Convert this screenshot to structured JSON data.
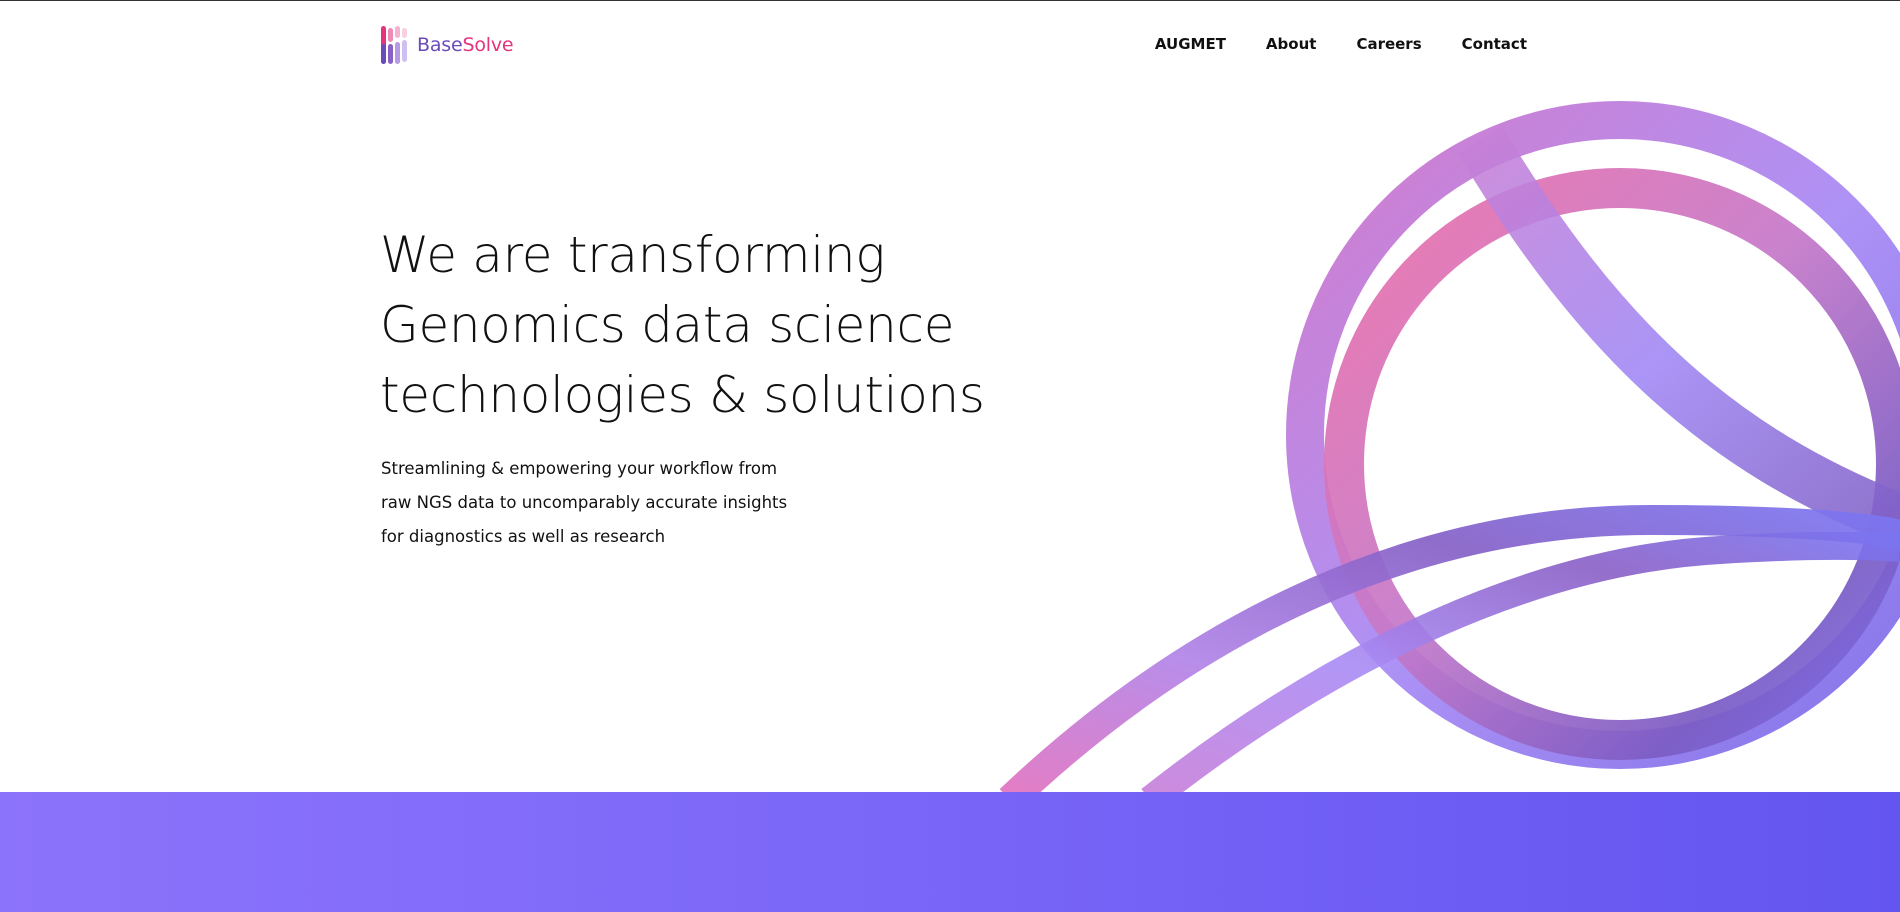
{
  "brand": {
    "name_part1": "Base",
    "name_part2": "Solve",
    "colors": {
      "purple": "#6b4bb8",
      "pink": "#e5337e"
    }
  },
  "nav": {
    "items": [
      {
        "label": "AUGMET"
      },
      {
        "label": "About"
      },
      {
        "label": "Careers"
      },
      {
        "label": "Contact"
      }
    ]
  },
  "hero": {
    "title_lines": [
      "We are transforming",
      "Genomics data science",
      "technologies & solutions"
    ],
    "subtitle_lines": [
      "Streamlining & empowering your workflow from",
      "raw NGS data to uncomparably accurate insights",
      "for diagnostics as well as research"
    ]
  },
  "theme": {
    "accent_pink": "#e8659f",
    "accent_violet": "#9b7cf5",
    "accent_indigo": "#6355f0",
    "band_gradient": [
      "#8c73fb",
      "#6355f0"
    ]
  }
}
